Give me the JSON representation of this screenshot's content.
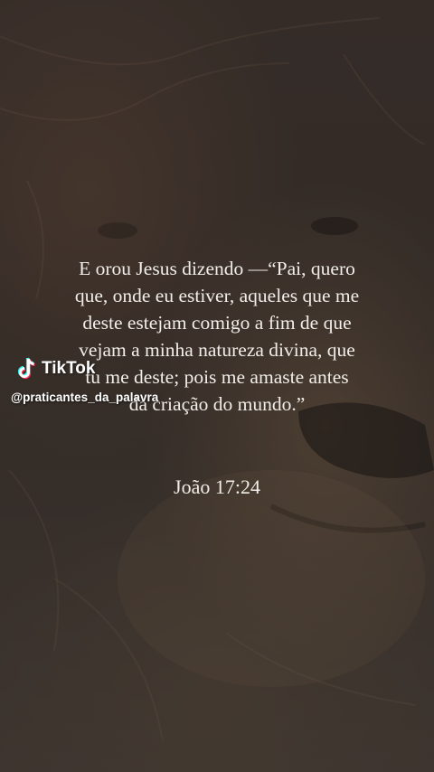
{
  "quote": {
    "lines": [
      "E orou Jesus dizendo —“Pai, quero",
      "que, onde eu estiver, aqueles que me",
      "deste estejam comigo a fim de que",
      "vejam a minha natureza divina, que",
      "tu me deste; pois me amaste antes",
      "da criação do mundo.”"
    ],
    "reference": "João 17:24"
  },
  "watermark": {
    "brand": "TikTok",
    "username": "@praticantes_da_palavra",
    "brand_color": "#ffffff",
    "accent_cyan": "#25f4ee",
    "accent_red": "#fe2c55"
  },
  "background": {
    "description_icon": "lion-image"
  }
}
